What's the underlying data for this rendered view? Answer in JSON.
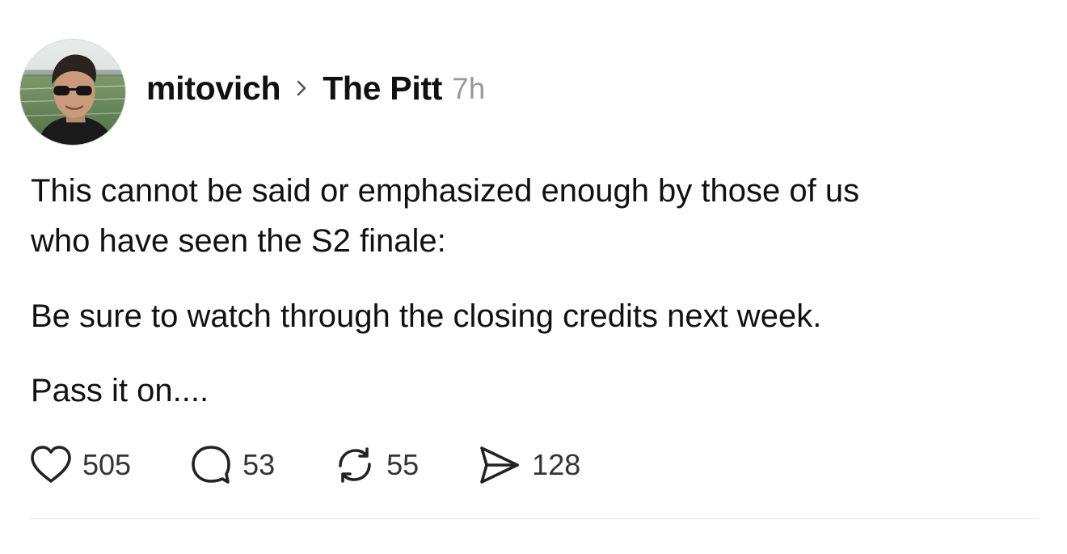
{
  "post": {
    "author": {
      "username": "mitovich",
      "avatar_icon": "profile-photo-avatar"
    },
    "breadcrumb_separator_icon": "chevron-right-icon",
    "community": "The Pitt",
    "time_ago": "7h",
    "body": {
      "paragraph_1_line_1": "This cannot be said or emphasized enough by those of us",
      "paragraph_1_line_2": "who have seen the S2 finale:",
      "paragraph_2": "Be sure to watch through the closing credits next week.",
      "paragraph_3": "Pass it on...."
    },
    "actions": {
      "likes": {
        "icon": "heart-icon",
        "count": "505"
      },
      "replies": {
        "icon": "comment-bubble-icon",
        "count": "53"
      },
      "reposts": {
        "icon": "repost-icon",
        "count": "55"
      },
      "shares": {
        "icon": "send-icon",
        "count": "128"
      }
    }
  },
  "colors": {
    "text_primary": "#111111",
    "text_secondary": "#9a9a9a",
    "icon_stroke": "#222222",
    "divider": "#e4e4e4",
    "background": "#ffffff"
  }
}
